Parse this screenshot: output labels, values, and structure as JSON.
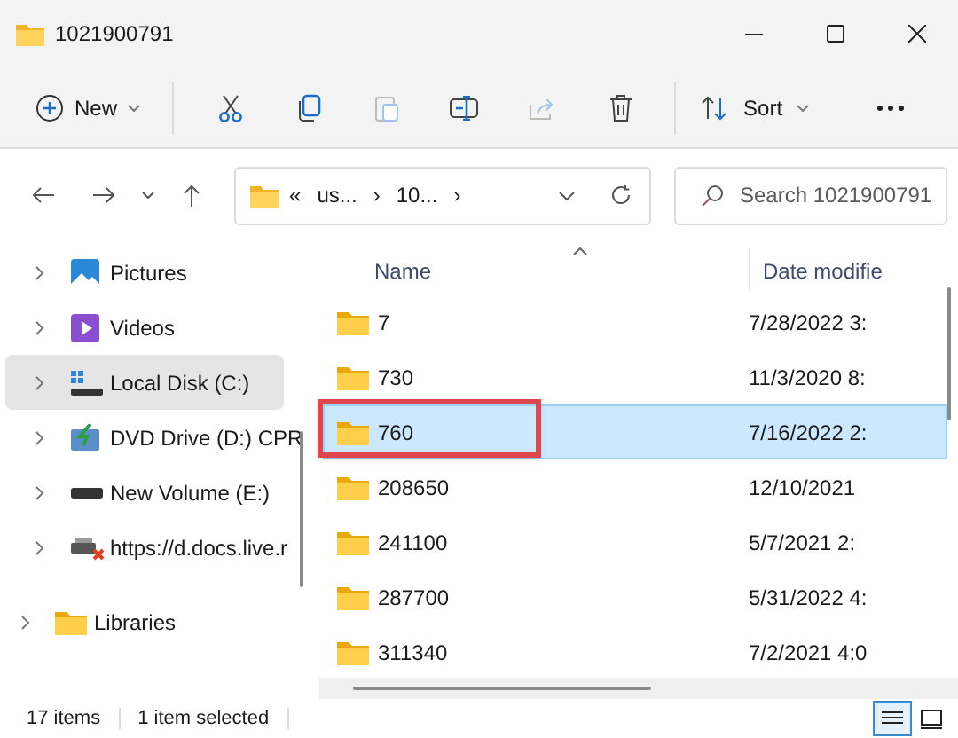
{
  "window": {
    "title": "1021900791"
  },
  "toolbar": {
    "new_label": "New",
    "sort_label": "Sort"
  },
  "address": {
    "segments": [
      "«",
      "us...",
      "›",
      "10...",
      "›"
    ],
    "search_placeholder": "Search 1021900791"
  },
  "sidebar": {
    "items": [
      {
        "label": "Pictures",
        "kind": "pictures",
        "selected": false
      },
      {
        "label": "Videos",
        "kind": "videos",
        "selected": false
      },
      {
        "label": "Local Disk (C:)",
        "kind": "disk",
        "selected": true
      },
      {
        "label": "DVD Drive (D:) CPR",
        "kind": "dvd",
        "selected": false
      },
      {
        "label": "New Volume (E:)",
        "kind": "drive",
        "selected": false
      },
      {
        "label": "https://d.docs.live.r",
        "kind": "netdrive",
        "selected": false
      },
      {
        "label": "Libraries",
        "kind": "libraries",
        "selected": false
      }
    ]
  },
  "table": {
    "columns": [
      "Name",
      "Date modifie"
    ],
    "rows": [
      {
        "name": "7",
        "date": "7/28/2022 3:",
        "selected": false,
        "highlighted": false
      },
      {
        "name": "730",
        "date": "11/3/2020 8:",
        "selected": false,
        "highlighted": false
      },
      {
        "name": "760",
        "date": "7/16/2022 2:",
        "selected": true,
        "highlighted": true
      },
      {
        "name": "208650",
        "date": "12/10/2021",
        "selected": false,
        "highlighted": false
      },
      {
        "name": "241100",
        "date": "5/7/2021 2:",
        "selected": false,
        "highlighted": false
      },
      {
        "name": "287700",
        "date": "5/31/2022 4:",
        "selected": false,
        "highlighted": false
      },
      {
        "name": "311340",
        "date": "7/2/2021 4:0",
        "selected": false,
        "highlighted": false
      }
    ]
  },
  "status_bar": {
    "item_count": "17 items",
    "selection": "1 item selected"
  }
}
